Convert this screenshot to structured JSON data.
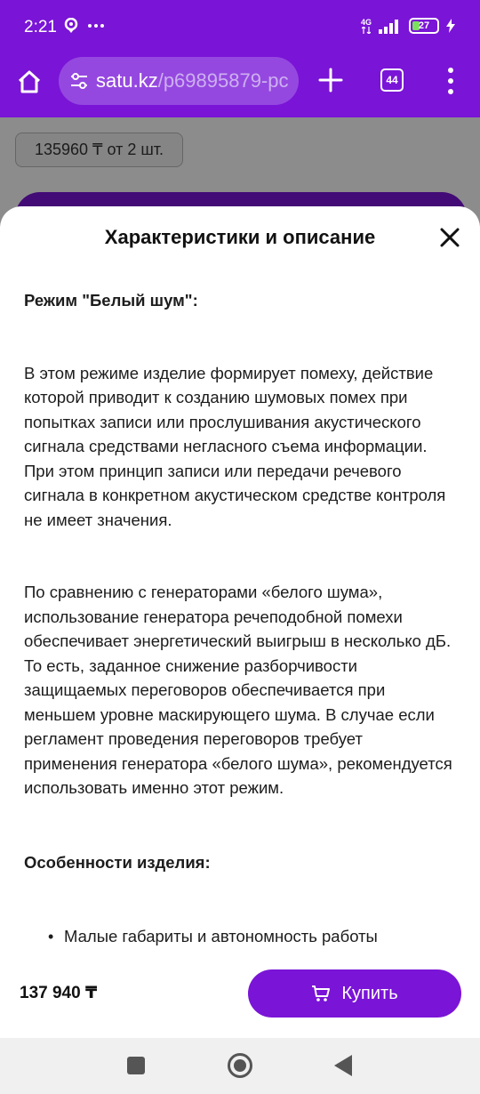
{
  "status_bar": {
    "time": "2:21",
    "network_label": "4G",
    "battery_level": "27"
  },
  "browser": {
    "url_domain": "satu.kz",
    "url_path": "/p69895879-pc",
    "tabs_count": "44"
  },
  "background_page": {
    "price_chip": "135960 ₸ от 2 шт."
  },
  "sheet": {
    "title": "Характеристики и описание",
    "heading1": "Режим \"Белый шум\":",
    "paragraph1": "В этом режиме изделие формирует помеху, действие которой приводит к созданию шумовых помех при попытках записи или прослушивания акустического сигнала средствами негласного съема информации. При этом принцип записи или передачи речевого сигнала в конкретном акустическом средстве контроля не имеет значения.",
    "paragraph2": "По сравнению с генераторами «белого шума», использование генератора речеподобной помехи обеспечивает энергетический выигрыш в несколько дБ. То есть, заданное снижение разборчивости защищаемых переговоров обеспечивается при меньшем уровне маскирующего шума. В случае если регламент проведения переговоров требует применения генератора «белого шума», рекомендуется использовать именно этот режим.",
    "heading2": "Особенности изделия:",
    "bullets": [
      "Малые габариты и автономность работы"
    ]
  },
  "bottom_bar": {
    "price": "137 940 ₸",
    "buy_label": "Купить"
  },
  "icons": {
    "home": "home-icon",
    "site_settings": "tune-icon",
    "new_tab": "plus-icon",
    "menu": "more-vert-icon",
    "close": "close-icon",
    "cart": "cart-icon"
  },
  "colors": {
    "brand": "#7a14d6",
    "url_box": "#9548e0"
  }
}
